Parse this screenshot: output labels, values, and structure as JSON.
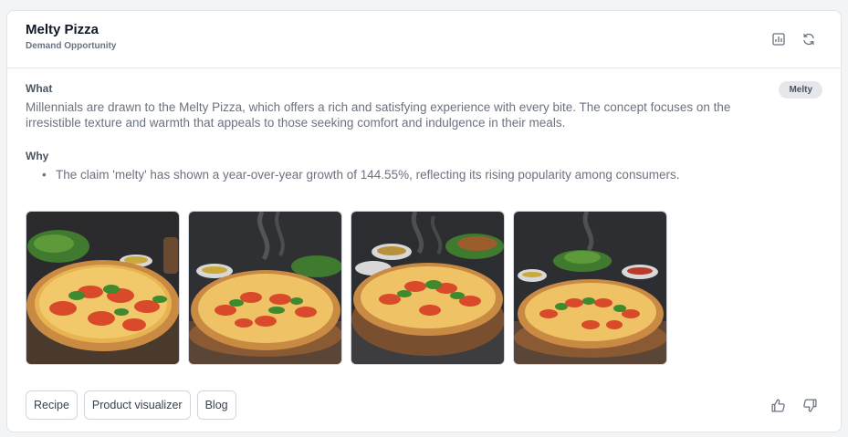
{
  "header": {
    "title": "Melty Pizza",
    "subtitle": "Demand Opportunity",
    "icons": [
      "chart-icon",
      "refresh-icon"
    ]
  },
  "what": {
    "label": "What",
    "text": "Millennials are drawn to the Melty Pizza, which offers a rich and satisfying experience with every bite. The concept focuses on the irresistible texture and warmth that appeals to those seeking comfort and indulgence in their meals.",
    "badge": "Melty"
  },
  "why": {
    "label": "Why",
    "items": [
      "The claim 'melty' has shown a year-over-year growth of 144.55%, reflecting its rising popularity among consumers."
    ]
  },
  "images": [
    {
      "alt": "pizza-image-1"
    },
    {
      "alt": "pizza-image-2"
    },
    {
      "alt": "pizza-image-3"
    },
    {
      "alt": "pizza-image-4"
    }
  ],
  "actions": {
    "recipe": "Recipe",
    "product_visualizer": "Product visualizer",
    "blog": "Blog"
  },
  "feedback": [
    "thumbs-up-icon",
    "thumbs-down-icon"
  ],
  "colors": {
    "card_bg": "#ffffff",
    "page_bg": "#f3f4f6",
    "title": "#111827",
    "body_text": "#6b7280",
    "badge_bg": "#e5e7eb"
  }
}
